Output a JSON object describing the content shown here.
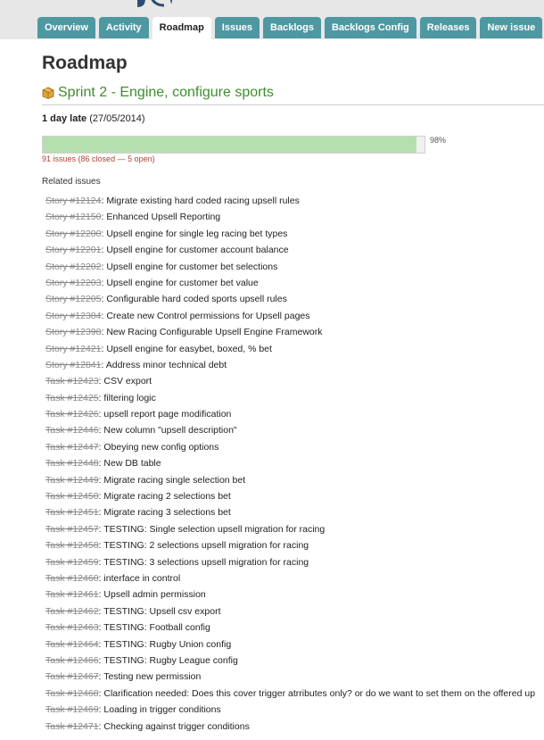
{
  "tabs": [
    {
      "label": "Overview",
      "selected": false
    },
    {
      "label": "Activity",
      "selected": false
    },
    {
      "label": "Roadmap",
      "selected": true
    },
    {
      "label": "Issues",
      "selected": false
    },
    {
      "label": "Backlogs",
      "selected": false
    },
    {
      "label": "Backlogs Config",
      "selected": false
    },
    {
      "label": "Releases",
      "selected": false
    },
    {
      "label": "New issue",
      "selected": false
    }
  ],
  "page_title": "Roadmap",
  "version": {
    "icon": "package-icon",
    "name": "Sprint 2 - Engine, configure sports"
  },
  "status": {
    "late_label": "1 day late",
    "due_date": "(27/05/2014)"
  },
  "progress": {
    "fraction": 0.98,
    "percent_label": "98%",
    "issues_label": "91 issues",
    "counts_label": "(86 closed — 5 open)"
  },
  "related_label": "Related issues",
  "issues": [
    {
      "ref": "Story #12124",
      "title": "Migrate existing hard coded racing upsell rules"
    },
    {
      "ref": "Story #12150",
      "title": "Enhanced Upsell Reporting"
    },
    {
      "ref": "Story #12200",
      "title": "Upsell engine for single leg racing bet types"
    },
    {
      "ref": "Story #12201",
      "title": "Upsell engine for customer account balance"
    },
    {
      "ref": "Story #12202",
      "title": "Upsell engine for customer bet selections"
    },
    {
      "ref": "Story #12203",
      "title": "Upsell engine for customer bet value"
    },
    {
      "ref": "Story #12205",
      "title": "Configurable hard coded sports upsell rules"
    },
    {
      "ref": "Story #12384",
      "title": "Create new Control permissions for Upsell pages"
    },
    {
      "ref": "Story #12398",
      "title": "New Racing Configurable Upsell Engine Framework"
    },
    {
      "ref": "Story #12421",
      "title": "Upsell engine for easybet, boxed, % bet"
    },
    {
      "ref": "Story #12841",
      "title": "Address minor technical debt"
    },
    {
      "ref": "Task #12423",
      "title": "CSV export"
    },
    {
      "ref": "Task #12425",
      "title": "filtering logic"
    },
    {
      "ref": "Task #12426",
      "title": "upsell report page modification"
    },
    {
      "ref": "Task #12446",
      "title": "New column \"upsell description\""
    },
    {
      "ref": "Task #12447",
      "title": "Obeying new config options"
    },
    {
      "ref": "Task #12448",
      "title": "New DB table"
    },
    {
      "ref": "Task #12449",
      "title": "Migrate racing single selection bet"
    },
    {
      "ref": "Task #12450",
      "title": "Migrate racing 2 selections bet"
    },
    {
      "ref": "Task #12451",
      "title": "Migrate racing 3 selections bet"
    },
    {
      "ref": "Task #12457",
      "title": "TESTING: Single selection upsell migration for racing"
    },
    {
      "ref": "Task #12458",
      "title": "TESTING: 2 selections upsell migration for racing"
    },
    {
      "ref": "Task #12459",
      "title": "TESTING: 3 selections upsell migration for racing"
    },
    {
      "ref": "Task #12460",
      "title": "interface in control"
    },
    {
      "ref": "Task #12461",
      "title": "Upsell admin permission"
    },
    {
      "ref": "Task #12462",
      "title": "TESTING: Upsell csv export"
    },
    {
      "ref": "Task #12463",
      "title": "TESTING: Football config"
    },
    {
      "ref": "Task #12464",
      "title": "TESTING: Rugby Union config"
    },
    {
      "ref": "Task #12466",
      "title": "TESTING: Rugby League config"
    },
    {
      "ref": "Task #12467",
      "title": "Testing new permission"
    },
    {
      "ref": "Task #12468",
      "title": "Clarification needed: Does this cover trigger atrributes only? or do we want to set them on the offered up"
    },
    {
      "ref": "Task #12469",
      "title": "Loading in trigger conditions"
    },
    {
      "ref": "Task #12471",
      "title": "Checking against trigger conditions"
    }
  ]
}
